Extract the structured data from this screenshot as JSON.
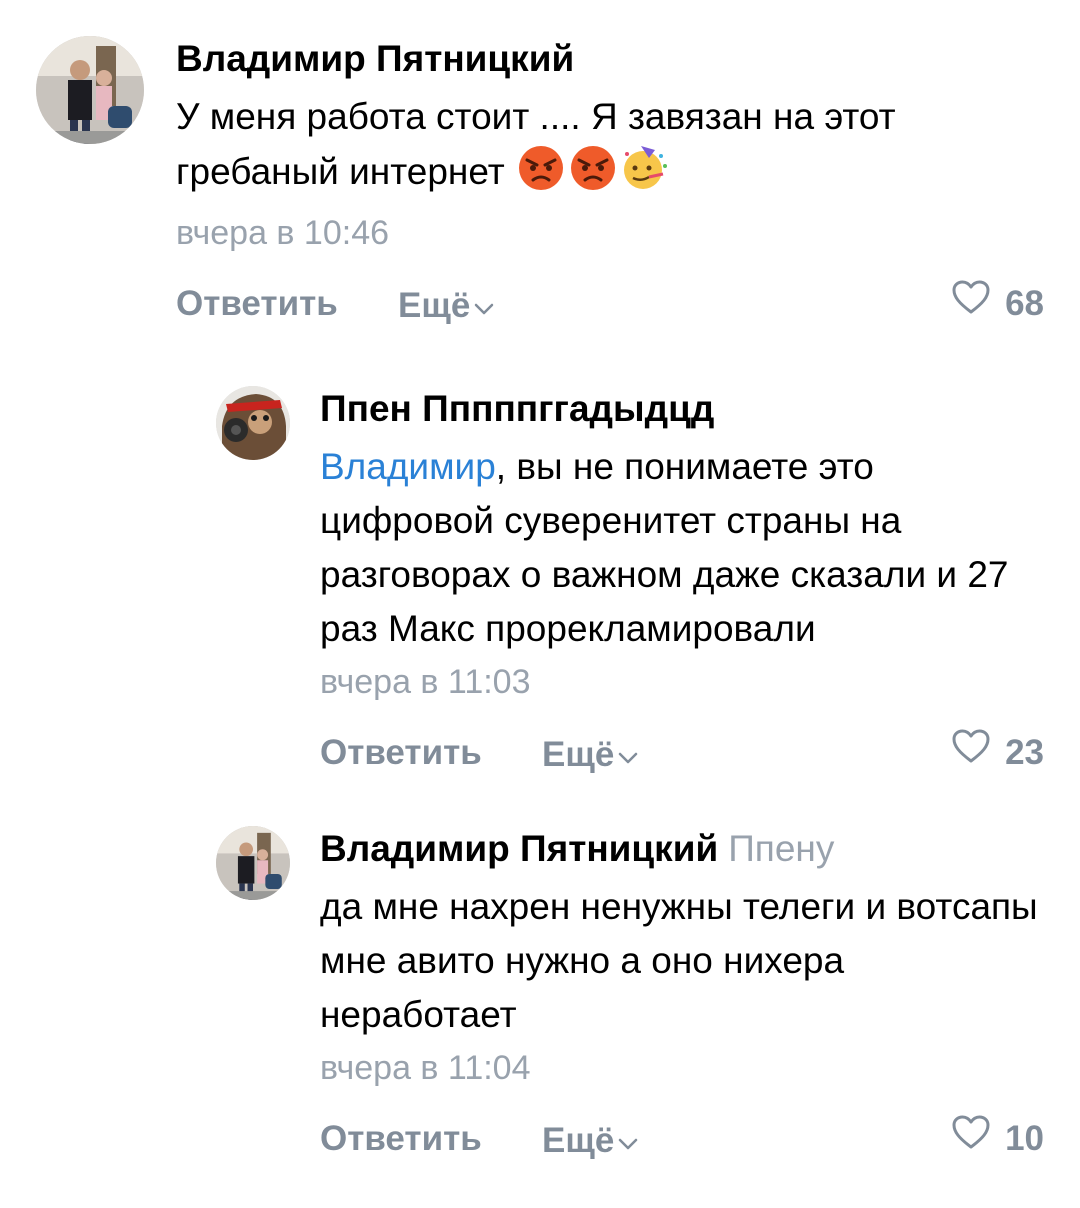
{
  "comments": [
    {
      "author": "Владимир Пятницкий",
      "text": "У меня работа стоит .... Я завязан на этот гребаный интернет",
      "emojis": [
        "angry-face-icon",
        "angry-face-icon",
        "party-face-icon"
      ],
      "time": "вчера в 10:46",
      "reply_label": "Ответить",
      "more_label": "Ещё",
      "likes": "68"
    },
    {
      "author": "Ппен Пппппггадыдцд",
      "mention": "Владимир",
      "text": ", вы не понимаете это цифровой суверенитет страны на разговорах о важном даже сказали и 27 раз Макс прорекламировали",
      "time": "вчера в 11:03",
      "reply_label": "Ответить",
      "more_label": "Ещё",
      "likes": "23"
    },
    {
      "author": "Владимир Пятницкий",
      "reply_to": "Ппену",
      "text": "да мне нахрен ненужны телеги и вотсапы мне авито нужно а оно нихера неработает",
      "time": "вчера в 11:04",
      "reply_label": "Ответить",
      "more_label": "Ещё",
      "likes": "10"
    }
  ],
  "colors": {
    "mention": "#2a81d6",
    "secondary": "#99a2ad",
    "action": "#818c99"
  }
}
